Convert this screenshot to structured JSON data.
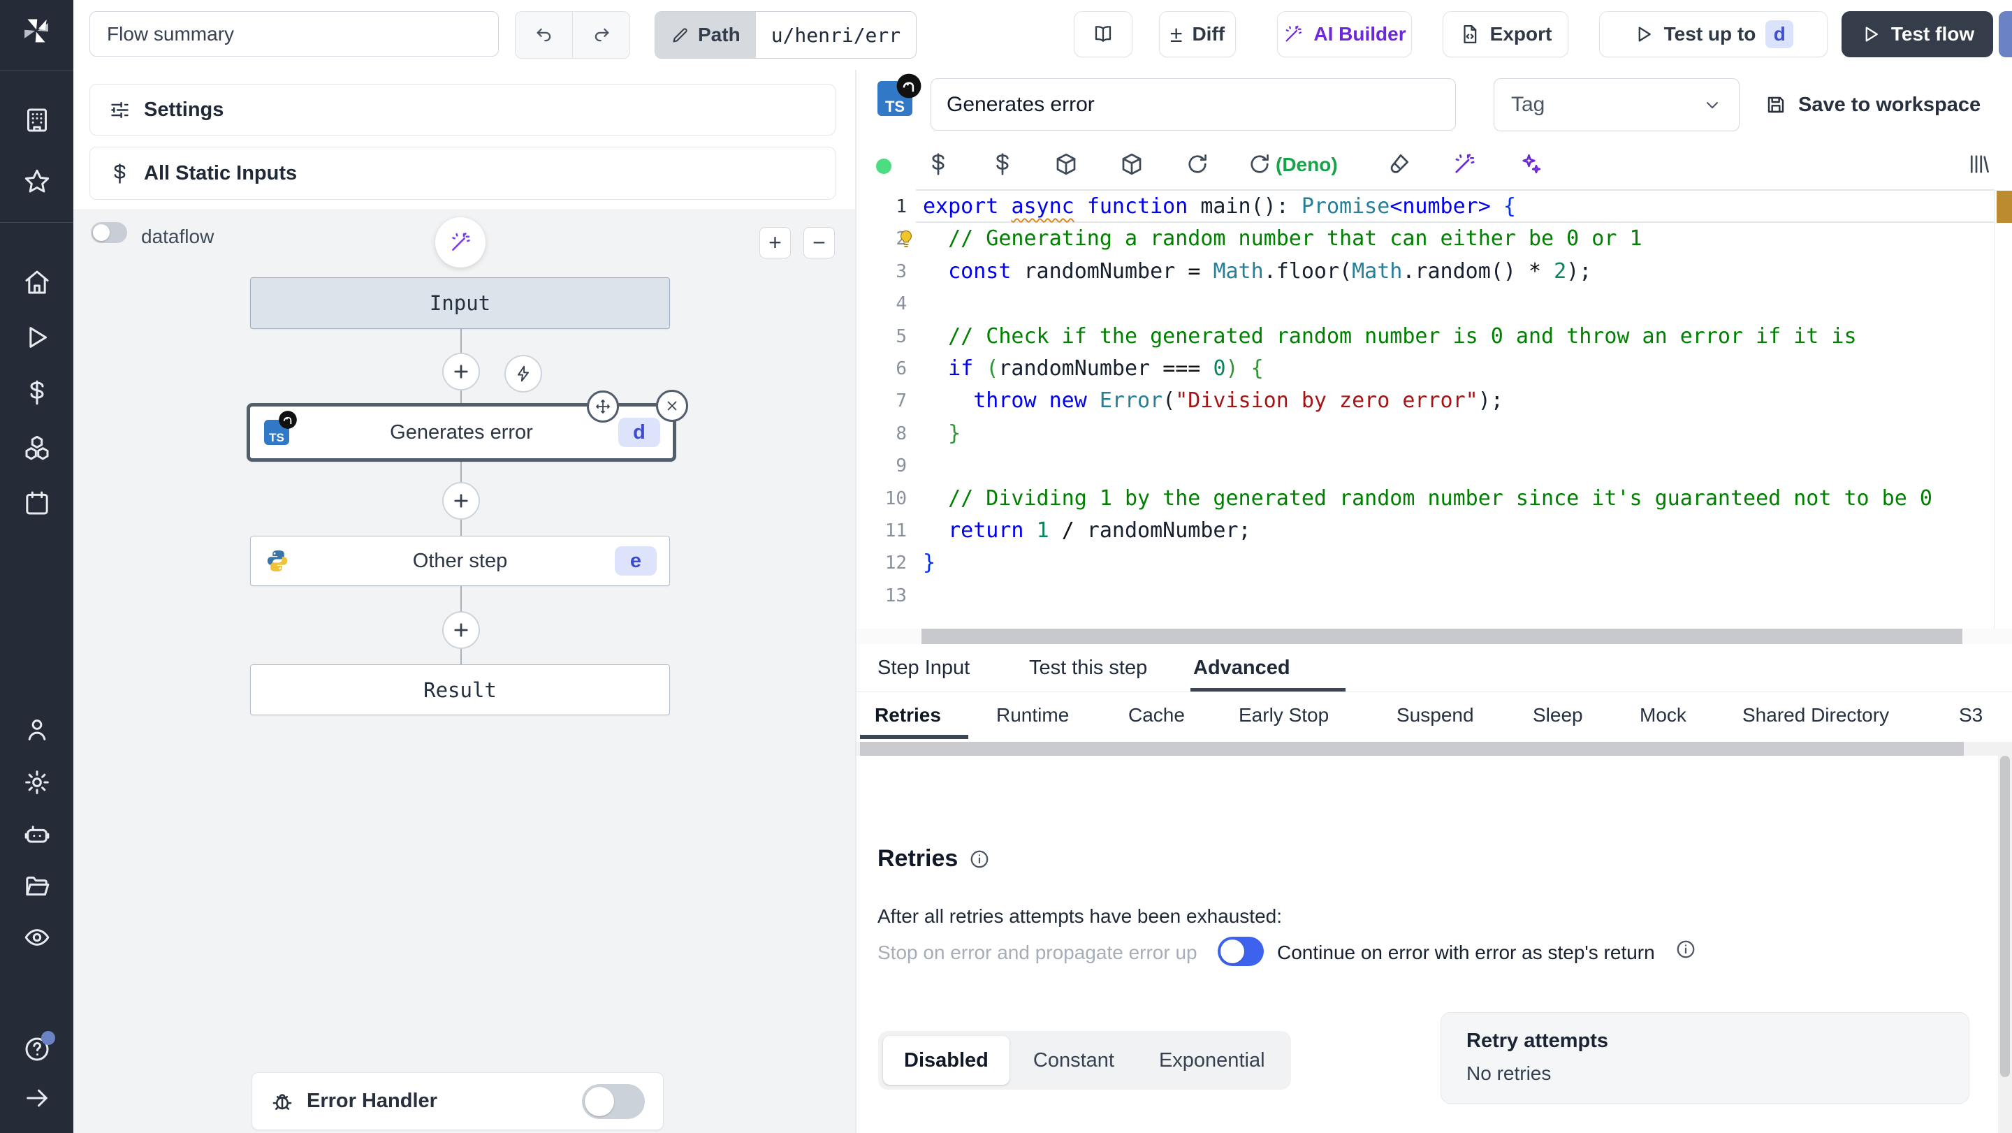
{
  "topbar": {
    "flow_summary": "Flow summary",
    "path_label": "Path",
    "path_value": "u/henri/err",
    "diff_label": "Diff",
    "ai_builder_label": "AI Builder",
    "export_label": "Export",
    "test_up_to_label": "Test up to",
    "test_up_to_badge": "d",
    "test_flow_label": "Test flow"
  },
  "sidebar": {
    "icons": [
      "building",
      "star",
      "home",
      "play",
      "dollar",
      "cubes",
      "calendar",
      "person",
      "gear",
      "robot",
      "folder",
      "eye",
      "help",
      "arrow-right"
    ]
  },
  "flow_panel": {
    "settings_label": "Settings",
    "static_inputs_label": "All Static Inputs",
    "dataflow_label": "dataflow",
    "zoom_in": "+",
    "zoom_out": "−",
    "input_node": "Input",
    "step_node": {
      "title": "Generates error",
      "badge": "d",
      "lang_badge": "TS"
    },
    "other_node": {
      "title": "Other step",
      "badge": "e"
    },
    "result_node": "Result",
    "error_handler_label": "Error Handler"
  },
  "step_editor": {
    "lang_badge": "TS",
    "name_value": "Generates error",
    "tag_placeholder": "Tag",
    "save_label": "Save to workspace",
    "toolbar": {
      "deno_label": "(Deno)",
      "icons": [
        "dollar",
        "dollar",
        "package",
        "package",
        "refresh",
        "refresh",
        "brush",
        "wand",
        "sparkles"
      ]
    },
    "code": {
      "lines": [
        {
          "segs": [
            [
              "kw",
              "export"
            ],
            [
              "pl",
              " "
            ],
            [
              "kw sq",
              "async"
            ],
            [
              "pl",
              " "
            ],
            [
              "kw",
              "function"
            ],
            [
              "pl",
              " "
            ],
            [
              "fn",
              "main"
            ],
            [
              "pl",
              "(): "
            ],
            [
              "ty",
              "Promise"
            ],
            [
              "kw",
              "<number>"
            ],
            [
              "pl",
              " "
            ],
            [
              "b1",
              "{"
            ]
          ]
        },
        {
          "bulb": true,
          "segs": [
            [
              "pl",
              "  "
            ],
            [
              "com",
              "// Generating a random number that can either be 0 or 1"
            ]
          ]
        },
        {
          "segs": [
            [
              "pl",
              "  "
            ],
            [
              "kw",
              "const"
            ],
            [
              "pl",
              " "
            ],
            [
              "fn",
              "randomNumber"
            ],
            [
              "pl",
              " "
            ],
            [
              "op",
              "="
            ],
            [
              "pl",
              " "
            ],
            [
              "ty",
              "Math"
            ],
            [
              "pl",
              ".floor("
            ],
            [
              "ty",
              "Math"
            ],
            [
              "pl",
              ".random() "
            ],
            [
              "op",
              "*"
            ],
            [
              "pl",
              " "
            ],
            [
              "num",
              "2"
            ],
            [
              "pl",
              ");"
            ]
          ]
        },
        {
          "segs": []
        },
        {
          "segs": [
            [
              "pl",
              "  "
            ],
            [
              "com",
              "// Check if the generated random number is 0 and throw an error if it is"
            ]
          ]
        },
        {
          "segs": [
            [
              "pl",
              "  "
            ],
            [
              "kw",
              "if"
            ],
            [
              "pl",
              " "
            ],
            [
              "b2",
              "("
            ],
            [
              "pl",
              "randomNumber "
            ],
            [
              "op",
              "==="
            ],
            [
              "pl",
              " "
            ],
            [
              "num",
              "0"
            ],
            [
              "b2",
              ")"
            ],
            [
              "pl",
              " "
            ],
            [
              "b2",
              "{"
            ]
          ]
        },
        {
          "segs": [
            [
              "pl",
              "    "
            ],
            [
              "kw",
              "throw"
            ],
            [
              "pl",
              " "
            ],
            [
              "kw",
              "new"
            ],
            [
              "pl",
              " "
            ],
            [
              "ty",
              "Error"
            ],
            [
              "pl",
              "("
            ],
            [
              "str",
              "\"Division by zero error\""
            ],
            [
              "pl",
              ");"
            ]
          ]
        },
        {
          "segs": [
            [
              "pl",
              "  "
            ],
            [
              "b2",
              "}"
            ]
          ]
        },
        {
          "segs": []
        },
        {
          "segs": [
            [
              "pl",
              "  "
            ],
            [
              "com",
              "// Dividing 1 by the generated random number since it's guaranteed not to be 0"
            ]
          ]
        },
        {
          "segs": [
            [
              "pl",
              "  "
            ],
            [
              "kw",
              "return"
            ],
            [
              "pl",
              " "
            ],
            [
              "num",
              "1"
            ],
            [
              "pl",
              " "
            ],
            [
              "op",
              "/"
            ],
            [
              "pl",
              " randomNumber;"
            ]
          ]
        },
        {
          "segs": [
            [
              "b1",
              "}"
            ]
          ]
        },
        {
          "segs": []
        }
      ]
    },
    "tabs": [
      "Step Input",
      "Test this step",
      "Advanced"
    ],
    "active_tab": "Advanced",
    "subtabs": [
      "Retries",
      "Runtime",
      "Cache",
      "Early Stop",
      "Suspend",
      "Sleep",
      "Mock",
      "Shared Directory",
      "S3"
    ],
    "active_subtab": "Retries",
    "retries": {
      "title": "Retries",
      "exhausted_text": "After all retries attempts have been exhausted:",
      "stop_label": "Stop on error and propagate error up",
      "continue_label": "Continue on error with error as step's return",
      "modes": [
        "Disabled",
        "Constant",
        "Exponential"
      ],
      "active_mode": "Disabled",
      "attempts_label": "Retry attempts",
      "attempts_value": "No retries"
    }
  },
  "colors": {
    "accent_purple": "#6d28d9",
    "toggle_blue": "#3d63ee",
    "badge_bg": "#dde3fb",
    "badge_text": "#3b4ad1",
    "status_green": "#4ade80",
    "deno_green": "#16a34a",
    "warning_marker": "#bd8b2f"
  }
}
